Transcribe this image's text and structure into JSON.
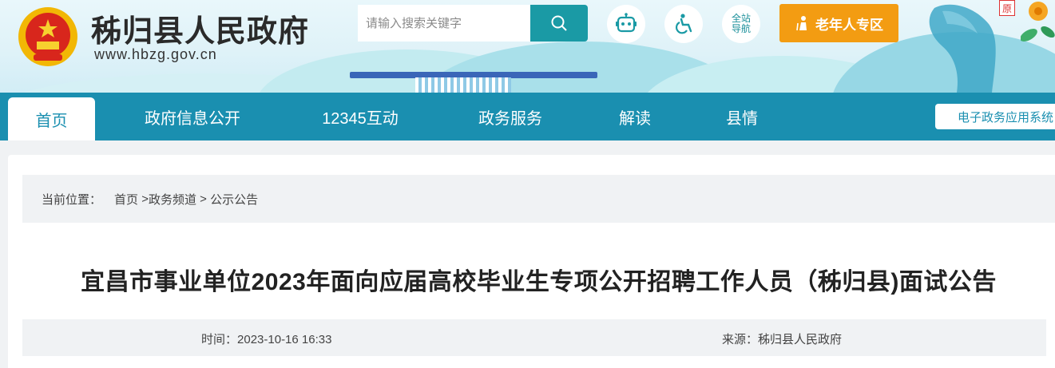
{
  "header": {
    "site_name": "秭归县人民政府",
    "site_url": "www.hbzg.gov.cn",
    "search_placeholder": "请输入搜索关键字",
    "nav_line1": "全站",
    "nav_line2": "导航",
    "elder_label": "老年人专区",
    "orig_badge": "原",
    "icons": [
      "emblem-icon",
      "search-icon",
      "robot-icon",
      "accessibility-icon",
      "elder-person-icon"
    ]
  },
  "navbar": {
    "items": [
      {
        "label": "首页",
        "active": true
      },
      {
        "label": "政府信息公开"
      },
      {
        "label": "12345互动"
      },
      {
        "label": "政务服务"
      },
      {
        "label": "解读"
      },
      {
        "label": "县情"
      }
    ],
    "right_button": "电子政务应用系统"
  },
  "breadcrumb": {
    "prefix": "当前位置：",
    "home": "首页",
    "sep1": " >",
    "channel": "政务频道",
    "sep2": " > ",
    "current": "公示公告"
  },
  "article": {
    "title": "宜昌市事业单位2023年面向应届高校毕业生专项公开招聘工作人员（秭归县)面试公告",
    "time_label": "时间：",
    "time_value": "2023-10-16 16:33",
    "source_label": "来源：",
    "source_value": "秭归县人民政府"
  },
  "colors": {
    "brand_teal": "#1a9aa5",
    "nav_blue": "#1a8fb0",
    "elder_orange": "#f39c12"
  }
}
